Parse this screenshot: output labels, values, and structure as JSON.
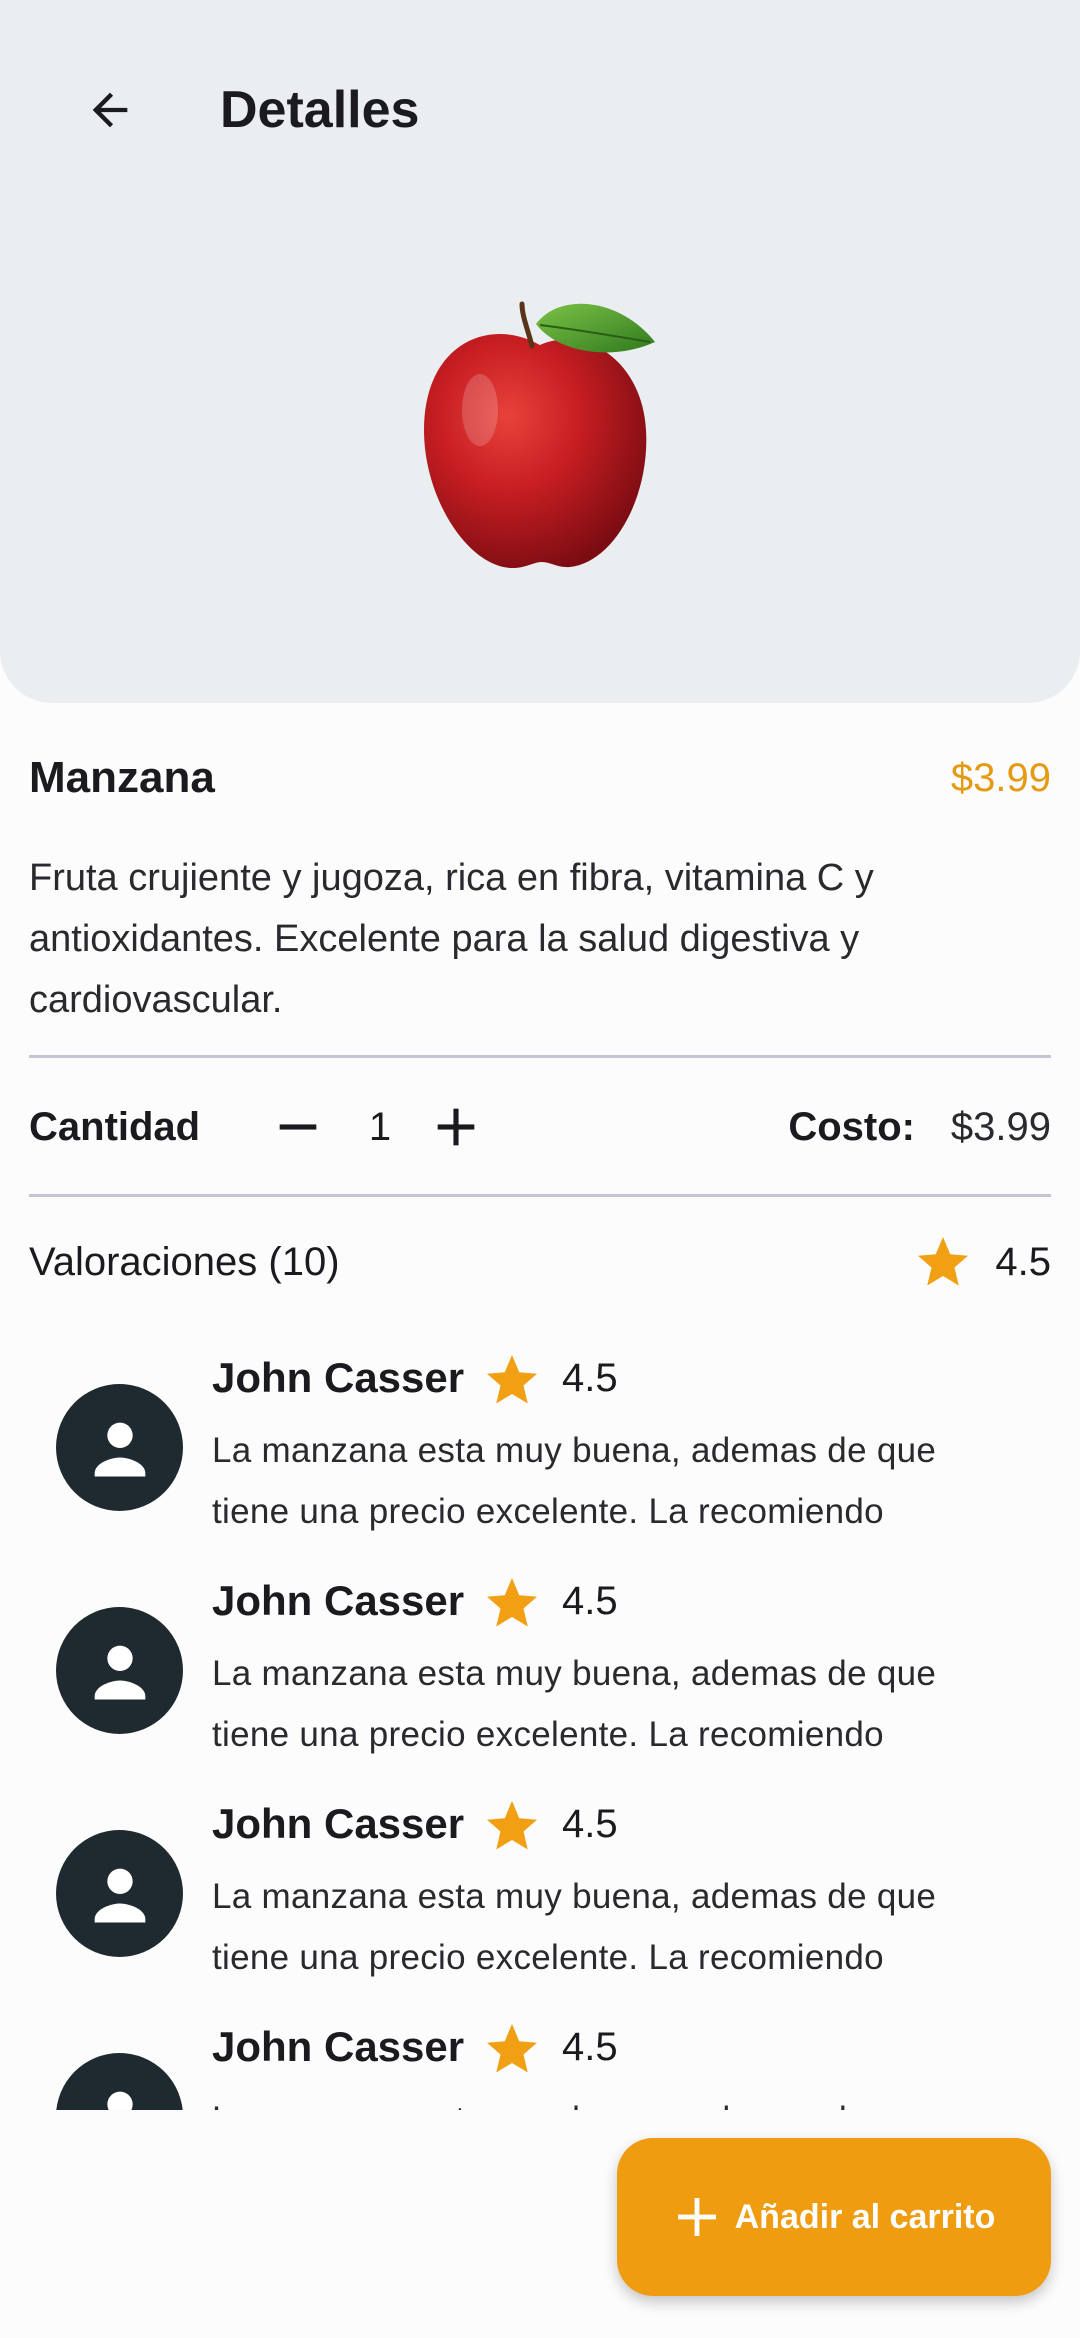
{
  "header": {
    "title": "Detalles",
    "back_icon": "arrow-left-icon"
  },
  "product": {
    "name": "Manzana",
    "price": "$3.99",
    "description": "Fruta crujiente y jugoza, rica en fibra, vitamina C y antioxidantes. Excelente para la salud digestiva y cardiovascular.",
    "image": "apple-image"
  },
  "quantity": {
    "label": "Cantidad",
    "value": "1",
    "decrement_icon": "minus-icon",
    "increment_icon": "plus-icon",
    "cost_label": "Costo:",
    "cost_value": "$3.99"
  },
  "ratings": {
    "label": "Valoraciones (10)",
    "average": "4.5",
    "star_icon": "star-icon"
  },
  "reviews": [
    {
      "name": "John Casser",
      "rating": "4.5",
      "text": "La manzana esta muy buena, ademas de que tiene una precio excelente. La recomiendo"
    },
    {
      "name": "John Casser",
      "rating": "4.5",
      "text": "La manzana esta muy buena, ademas de que tiene una precio excelente. La recomiendo"
    },
    {
      "name": "John Casser",
      "rating": "4.5",
      "text": "La manzana esta muy buena, ademas de que tiene una precio excelente. La recomiendo"
    },
    {
      "name": "John Casser",
      "rating": "4.5",
      "text": "La manzana esta muy buena, ademas de que tiene una precio excelente. La recomiendo"
    }
  ],
  "fab": {
    "label": "Añadir al carrito",
    "icon": "plus-icon"
  },
  "colors": {
    "accent": "#F09C10",
    "price": "#E49A12",
    "star": "#F0A012",
    "avatar": "#1F2A30",
    "hero_background": "#EAEEF1"
  }
}
